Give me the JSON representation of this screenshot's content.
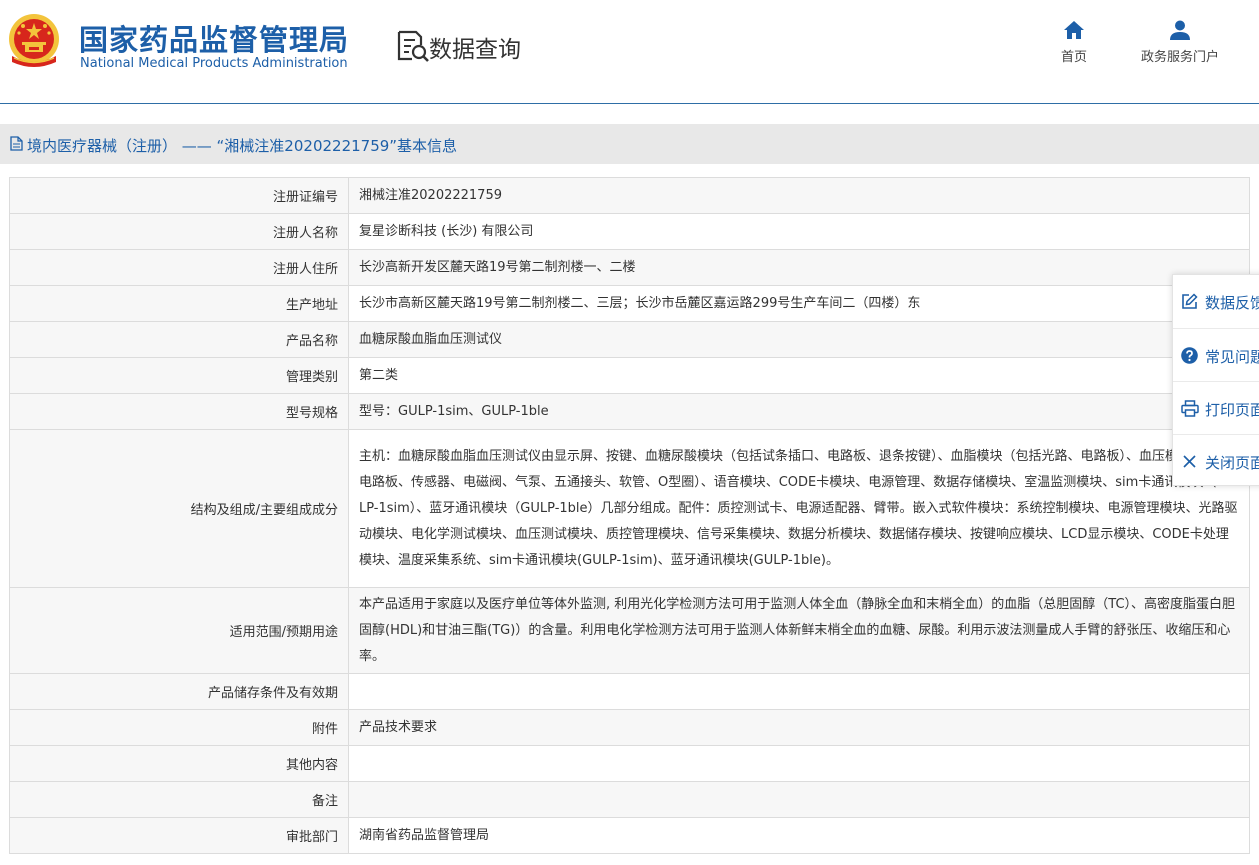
{
  "header": {
    "org_name_cn": "国家药品监督管理局",
    "org_name_en": "National Medical Products Administration",
    "section_title": "数据查询",
    "nav": [
      {
        "label": "首页",
        "icon": "home-icon"
      },
      {
        "label": "政务服务门户",
        "icon": "user-icon"
      }
    ]
  },
  "page_title": "境内医疗器械（注册） —— “湘械注准20202221759”基本信息",
  "rows": [
    {
      "label": "注册证编号",
      "value": "湘械注准20202221759"
    },
    {
      "label": "注册人名称",
      "value": "复星诊断科技 (长沙) 有限公司"
    },
    {
      "label": "注册人住所",
      "value": "长沙高新开发区麓天路19号第二制剂楼一、二楼"
    },
    {
      "label": "生产地址",
      "value": "长沙市高新区麓天路19号第二制剂楼二、三层；长沙市岳麓区嘉运路299号生产车间二（四楼）东"
    },
    {
      "label": "产品名称",
      "value": "血糖尿酸血脂血压测试仪"
    },
    {
      "label": "管理类别",
      "value": "第二类"
    },
    {
      "label": "型号规格",
      "value": "型号：GULP-1sim、GULP-1ble"
    },
    {
      "label": "结构及组成/主要组成成分",
      "value": "主机：血糖尿酸血脂血压测试仪由显示屏、按键、血糖尿酸模块（包括试条插口、电路板、退条按键）、血脂模块（包括光路、电路板）、血压模块（包括电路板、传感器、电磁阀、气泵、五通接头、软管、O型圈）、语音模块、CODE卡模块、电源管理、数据存储模块、室温监测模块、sim卡通讯模块（GULP-1sim）、蓝牙通讯模块（GULP-1ble）几部分组成。配件：质控测试卡、电源适配器、臂带。嵌入式软件模块：系统控制模块、电源管理模块、光路驱动模块、电化学测试模块、血压测试模块、质控管理模块、信号采集模块、数据分析模块、数据储存模块、按键响应模块、LCD显示模块、CODE卡处理模块、温度采集系统、sim卡通讯模块(GULP-1sim)、蓝牙通讯模块(GULP-1ble)。"
    },
    {
      "label": "适用范围/预期用途",
      "value": "本产品适用于家庭以及医疗单位等体外监测, 利用光化学检测方法可用于监测人体全血（静脉全血和末梢全血）的血脂（总胆固醇（TC）、高密度脂蛋白胆固醇(HDL)和甘油三酯(TG)）的含量。利用电化学检测方法可用于监测人体新鲜末梢全血的血糖、尿酸。利用示波法测量成人手臂的舒张压、收缩压和心率。"
    },
    {
      "label": "产品储存条件及有效期",
      "value": ""
    },
    {
      "label": "附件",
      "value": "产品技术要求"
    },
    {
      "label": "其他内容",
      "value": ""
    },
    {
      "label": "备注",
      "value": ""
    },
    {
      "label": "审批部门",
      "value": "湖南省药品监督管理局"
    }
  ],
  "side_panel": [
    {
      "label": "数据反馈",
      "icon": "edit-icon"
    },
    {
      "label": "常见问题",
      "icon": "help-icon"
    },
    {
      "label": "打印页面",
      "icon": "print-icon"
    },
    {
      "label": "关闭页面",
      "icon": "close-icon"
    }
  ],
  "colors": {
    "brand_blue": "#1d5fa8",
    "emblem_red": "#d7261c",
    "emblem_gold": "#f3c43c"
  }
}
